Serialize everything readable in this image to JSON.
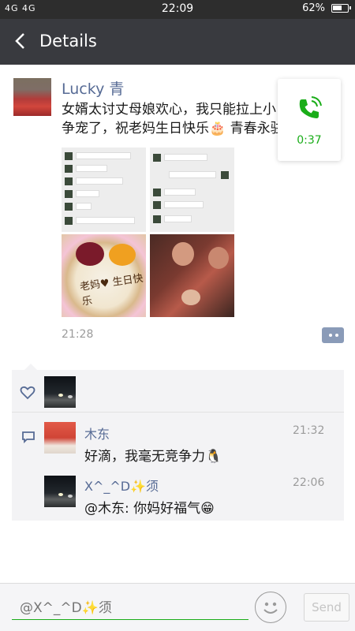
{
  "status_bar": {
    "network": "4G 4G",
    "time": "22:09",
    "battery_text": "62%",
    "battery_level": 0.62
  },
  "nav": {
    "title": "Details"
  },
  "post": {
    "author": "Lucky 青",
    "text": "女婿太讨丈母娘欢心，我只能拉上小 争宠了，祝老妈生日快乐🎂 青春永驻",
    "time": "21:28",
    "cake_text": "老妈♥ 生日快乐"
  },
  "call_widget": {
    "duration": "0:37"
  },
  "comments": [
    {
      "author": "木东",
      "time": "21:32",
      "text": "好滴，我毫无竞争力🐧"
    },
    {
      "author": "X^_^D✨须",
      "time": "22:06",
      "text": "@木东: 你妈好福气😁"
    }
  ],
  "input": {
    "placeholder": "@X^_^D✨须",
    "send_label": "Send"
  },
  "colors": {
    "link": "#576b95",
    "accent_green": "#1aad19",
    "nav_bg": "#393a3f",
    "status_bg": "#2d2d2d"
  },
  "icons": {
    "back": "chevron-left-icon",
    "like": "heart-icon",
    "comment": "speech-bubble-icon",
    "call": "phone-icon",
    "emoji": "smiley-icon",
    "more": "comment-dots-icon"
  }
}
